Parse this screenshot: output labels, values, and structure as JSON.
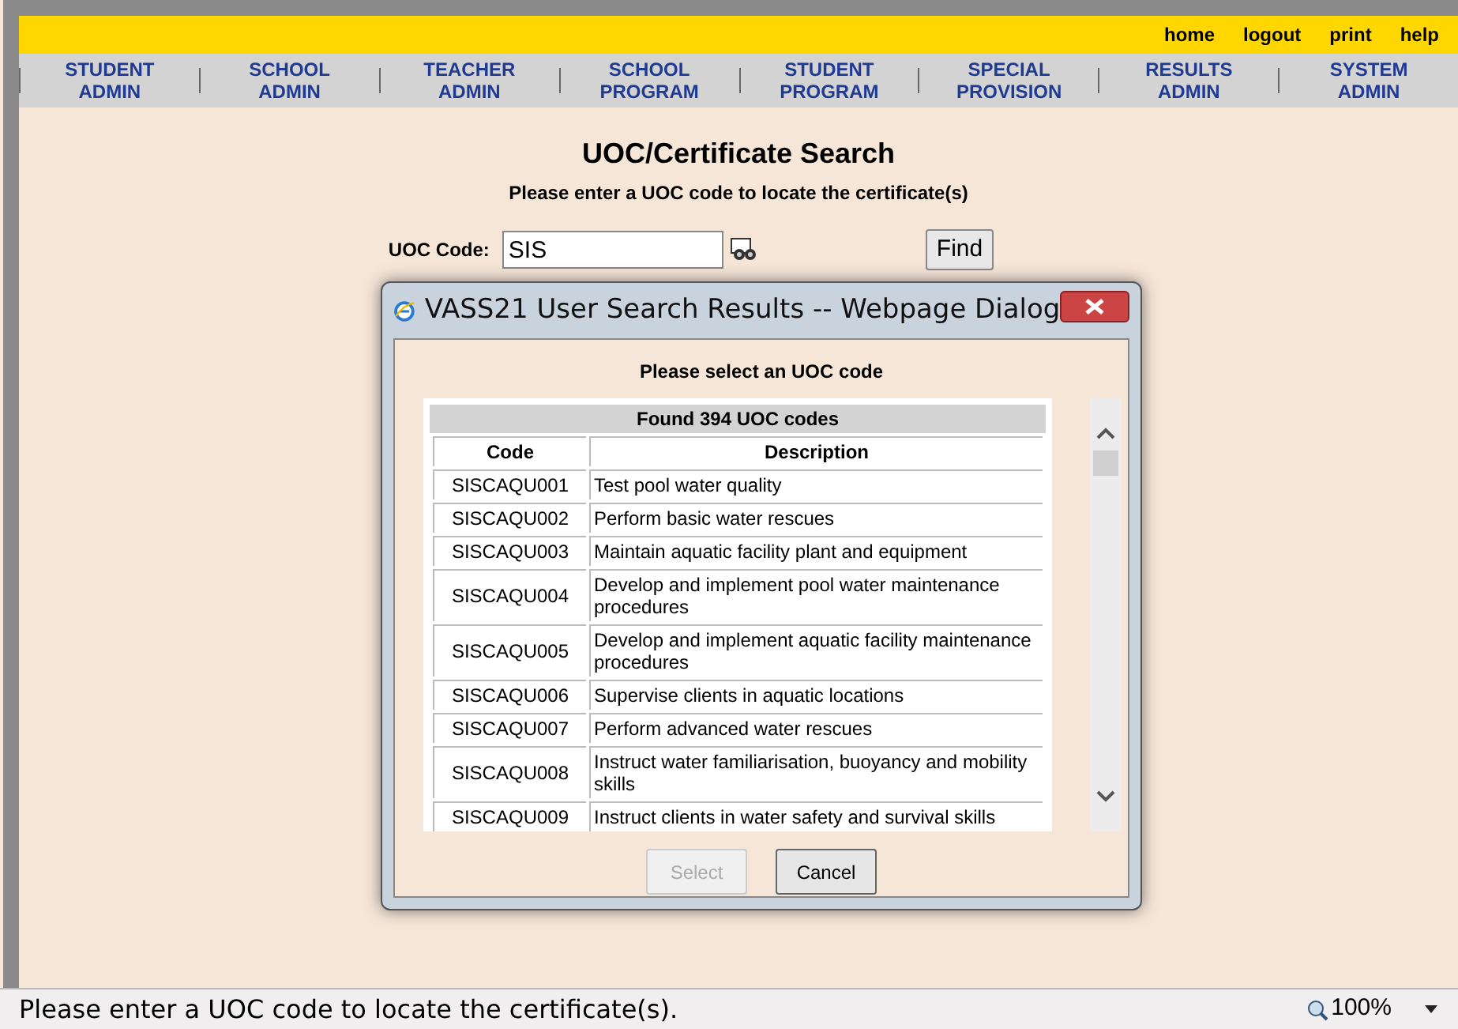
{
  "top_links": [
    "home",
    "logout",
    "print",
    "help"
  ],
  "nav": [
    {
      "line1": "STUDENT",
      "line2": "ADMIN"
    },
    {
      "line1": "SCHOOL",
      "line2": "ADMIN"
    },
    {
      "line1": "TEACHER",
      "line2": "ADMIN"
    },
    {
      "line1": "SCHOOL",
      "line2": "PROGRAM"
    },
    {
      "line1": "STUDENT",
      "line2": "PROGRAM"
    },
    {
      "line1": "SPECIAL",
      "line2": "PROVISION"
    },
    {
      "line1": "RESULTS",
      "line2": "ADMIN"
    },
    {
      "line1": "SYSTEM",
      "line2": "ADMIN"
    }
  ],
  "page": {
    "title": "UOC/Certificate Search",
    "subtitle": "Please enter a UOC code to locate the certificate(s)",
    "field_label": "UOC Code:",
    "field_value": "SIS",
    "find_button": "Find"
  },
  "dialog": {
    "title": "VASS21 User Search Results -- Webpage Dialog",
    "prompt": "Please select an UOC code",
    "table_caption": "Found 394 UOC codes",
    "columns": [
      "Code",
      "Description"
    ],
    "rows": [
      {
        "code": "SISCAQU001",
        "description": "Test pool water quality"
      },
      {
        "code": "SISCAQU002",
        "description": "Perform basic water rescues"
      },
      {
        "code": "SISCAQU003",
        "description": "Maintain aquatic facility plant and equipment"
      },
      {
        "code": "SISCAQU004",
        "description": "Develop and implement pool water maintenance procedures"
      },
      {
        "code": "SISCAQU005",
        "description": "Develop and implement aquatic facility maintenance procedures"
      },
      {
        "code": "SISCAQU006",
        "description": "Supervise clients in aquatic locations"
      },
      {
        "code": "SISCAQU007",
        "description": "Perform advanced water rescues"
      },
      {
        "code": "SISCAQU008",
        "description": "Instruct water familiarisation, buoyancy and mobility skills"
      },
      {
        "code": "SISCAQU009",
        "description": "Instruct clients in water safety and survival skills"
      }
    ],
    "buttons": [
      {
        "label": "Select",
        "disabled": true
      },
      {
        "label": "Cancel",
        "disabled": false
      }
    ]
  },
  "status_bar": {
    "message": "Please enter a UOC code to locate the certificate(s).",
    "zoom": "100%"
  }
}
